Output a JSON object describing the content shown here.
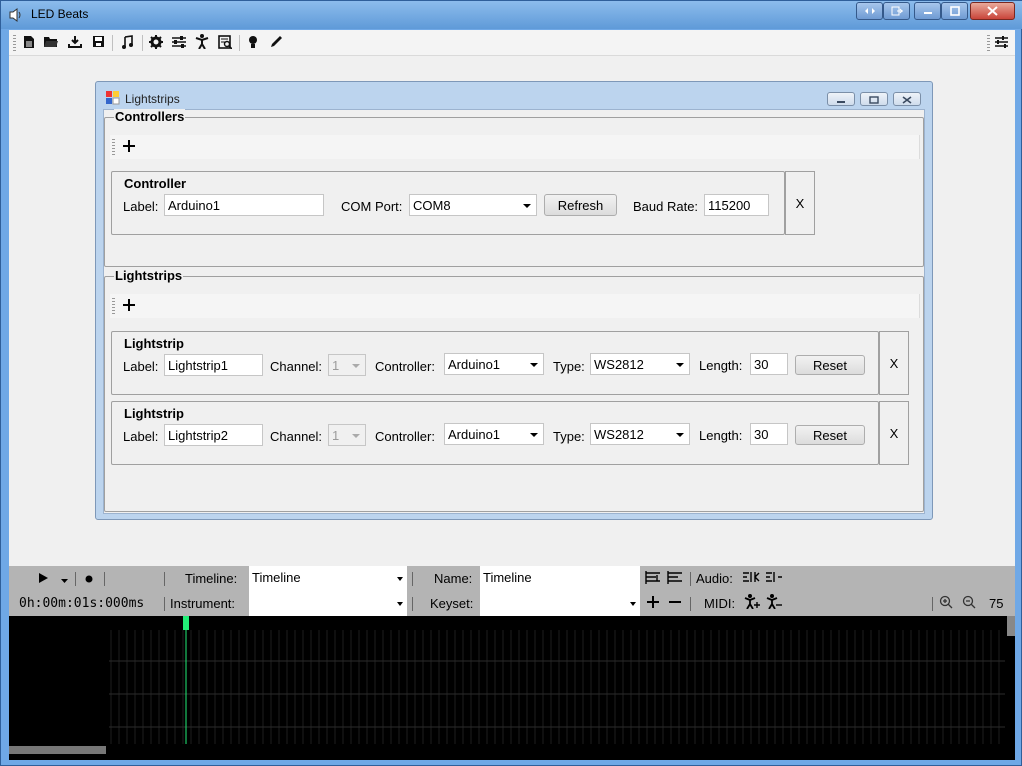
{
  "app": {
    "title": "LED Beats"
  },
  "toolbar": {
    "left_icons": [
      "new-file-icon",
      "open-folder-icon",
      "import-icon",
      "save-icon",
      "music-note-icon",
      "settings-gear-icon",
      "sliders-icon",
      "lightstrip-figure-icon",
      "log-search-icon",
      "lightbulb-icon",
      "pencil-icon"
    ],
    "right_icon": "settings-sliders-icon"
  },
  "lightstrips_window": {
    "title": "Lightstrips",
    "controllers": {
      "group_title": "Controllers",
      "add_label": "+",
      "items": [
        {
          "group_title": "Controller",
          "label_caption": "Label:",
          "label_value": "Arduino1",
          "com_caption": "COM Port:",
          "com_value": "COM8",
          "refresh_label": "Refresh",
          "baud_caption": "Baud Rate:",
          "baud_value": "115200",
          "remove_label": "X"
        }
      ]
    },
    "lightstrips": {
      "group_title": "Lightstrips",
      "add_label": "+",
      "items": [
        {
          "group_title": "Lightstrip",
          "label_caption": "Label:",
          "label_value": "Lightstrip1",
          "channel_caption": "Channel:",
          "channel_value": "1",
          "controller_caption": "Controller:",
          "controller_value": "Arduino1",
          "type_caption": "Type:",
          "type_value": "WS2812",
          "length_caption": "Length:",
          "length_value": "30",
          "reset_label": "Reset",
          "remove_label": "X"
        },
        {
          "group_title": "Lightstrip",
          "label_caption": "Label:",
          "label_value": "Lightstrip2",
          "channel_caption": "Channel:",
          "channel_value": "1",
          "controller_caption": "Controller:",
          "controller_value": "Arduino1",
          "type_caption": "Type:",
          "type_value": "WS2812",
          "length_caption": "Length:",
          "length_value": "30",
          "reset_label": "Reset",
          "remove_label": "X"
        }
      ]
    }
  },
  "transport": {
    "time": "0h:00m:01s:000ms",
    "timeline_caption": "Timeline:",
    "timeline_value": "Timeline",
    "name_caption": "Name:",
    "name_value": "Timeline",
    "audio_caption": "Audio:",
    "instrument_caption": "Instrument:",
    "instrument_value": "",
    "keyset_caption": "Keyset:",
    "keyset_value": "",
    "midi_caption": "MIDI:",
    "zoom_value": "75"
  },
  "colors": {
    "titlebar": "#6fa8e6",
    "timeline_bg": "#000000",
    "playhead": "#22ee77",
    "bar_bg": "#b4b4b4"
  }
}
